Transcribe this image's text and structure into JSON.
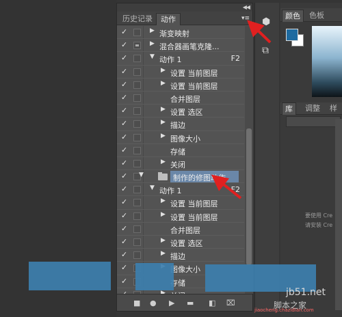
{
  "panel": {
    "tabs": [
      "历史记录",
      "动作"
    ],
    "active_tab": "动作"
  },
  "actions_list": [
    {
      "checked": true,
      "box": "",
      "expander": "right",
      "indent": 1,
      "label": "渐变映射",
      "shortcut": ""
    },
    {
      "checked": true,
      "box": "filled",
      "expander": "right",
      "indent": 1,
      "label": "混合器画笔克隆...",
      "shortcut": ""
    },
    {
      "checked": true,
      "box": "",
      "expander": "down",
      "indent": 1,
      "label": "动作 1",
      "shortcut": "F2"
    },
    {
      "checked": true,
      "box": "",
      "expander": "right",
      "indent": 2,
      "label": "设置 当前图层",
      "shortcut": ""
    },
    {
      "checked": true,
      "box": "",
      "expander": "right",
      "indent": 2,
      "label": "设置 当前图层",
      "shortcut": ""
    },
    {
      "checked": true,
      "box": "",
      "expander": "none",
      "indent": 2,
      "label": "合并图层",
      "shortcut": ""
    },
    {
      "checked": true,
      "box": "",
      "expander": "right",
      "indent": 2,
      "label": "设置 选区",
      "shortcut": ""
    },
    {
      "checked": true,
      "box": "",
      "expander": "right",
      "indent": 2,
      "label": "描边",
      "shortcut": ""
    },
    {
      "checked": true,
      "box": "",
      "expander": "right",
      "indent": 2,
      "label": "图像大小",
      "shortcut": ""
    },
    {
      "checked": true,
      "box": "",
      "expander": "none",
      "indent": 2,
      "label": "存储",
      "shortcut": ""
    },
    {
      "checked": true,
      "box": "",
      "expander": "right",
      "indent": 2,
      "label": "关闭",
      "shortcut": ""
    },
    {
      "checked": true,
      "box": "",
      "expander": "down",
      "indent": 0,
      "label": "制作的修图动作",
      "shortcut": "",
      "folder": true,
      "selected": true
    },
    {
      "checked": true,
      "box": "",
      "expander": "down",
      "indent": 1,
      "label": "动作 1",
      "shortcut": "F2"
    },
    {
      "checked": true,
      "box": "",
      "expander": "right",
      "indent": 2,
      "label": "设置 当前图层",
      "shortcut": ""
    },
    {
      "checked": true,
      "box": "",
      "expander": "right",
      "indent": 2,
      "label": "设置 当前图层",
      "shortcut": ""
    },
    {
      "checked": true,
      "box": "",
      "expander": "none",
      "indent": 2,
      "label": "合并图层",
      "shortcut": ""
    },
    {
      "checked": true,
      "box": "",
      "expander": "right",
      "indent": 2,
      "label": "设置 选区",
      "shortcut": ""
    },
    {
      "checked": true,
      "box": "",
      "expander": "right",
      "indent": 2,
      "label": "描边",
      "shortcut": ""
    },
    {
      "checked": true,
      "box": "",
      "expander": "right",
      "indent": 2,
      "label": "图像大小",
      "shortcut": ""
    },
    {
      "checked": true,
      "box": "",
      "expander": "none",
      "indent": 2,
      "label": "存储",
      "shortcut": ""
    },
    {
      "checked": true,
      "box": "",
      "expander": "right",
      "indent": 2,
      "label": "关闭",
      "shortcut": ""
    }
  ],
  "toolbar_icons": [
    "stop-icon",
    "record-icon",
    "play-icon",
    "new-set-icon",
    "new-action-icon",
    "delete-icon"
  ],
  "right_panel": {
    "tabs": [
      "颜色",
      "色板"
    ],
    "tabs2": [
      "库",
      "调整",
      "样"
    ],
    "msg_line1": "要使用 Cre",
    "msg_line2": "请安装 Cre"
  },
  "watermark": {
    "site": "jb51.net",
    "site2": "脚本之家",
    "url": "jiaocheng.chazidian.com"
  },
  "colors": {
    "foreground": "#1d6aa0",
    "background": "#ffffff",
    "selection": "#6a87a8",
    "annotation_arrow": "#e02020"
  }
}
